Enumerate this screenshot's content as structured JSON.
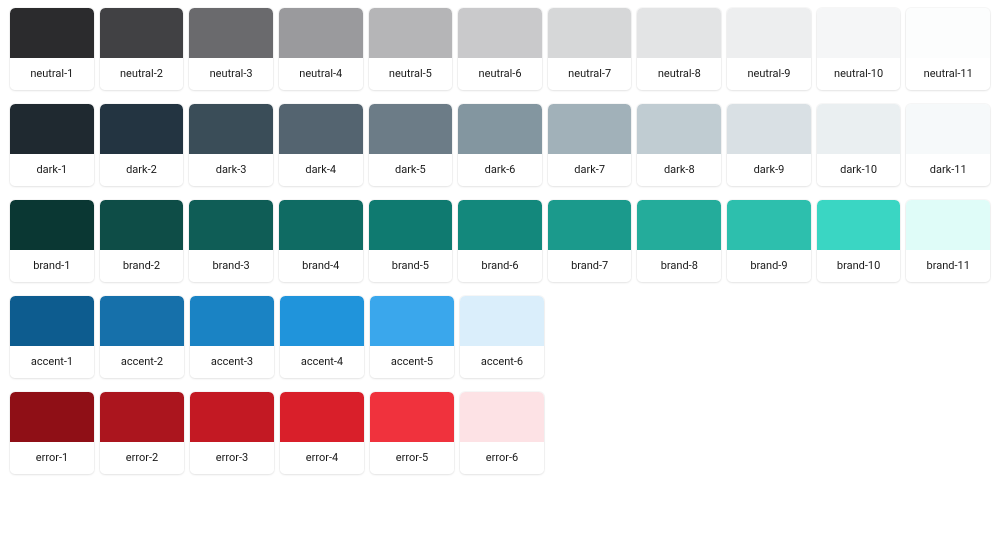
{
  "palettes": [
    {
      "name": "neutral",
      "swatches": [
        {
          "label": "neutral-1",
          "color": "#2b2b2d"
        },
        {
          "label": "neutral-2",
          "color": "#414144"
        },
        {
          "label": "neutral-3",
          "color": "#6a6a6d"
        },
        {
          "label": "neutral-4",
          "color": "#9a9a9d"
        },
        {
          "label": "neutral-5",
          "color": "#b5b5b7"
        },
        {
          "label": "neutral-6",
          "color": "#c9c9cb"
        },
        {
          "label": "neutral-7",
          "color": "#d6d7d8"
        },
        {
          "label": "neutral-8",
          "color": "#e3e4e5"
        },
        {
          "label": "neutral-9",
          "color": "#edeeef"
        },
        {
          "label": "neutral-10",
          "color": "#f5f6f7"
        },
        {
          "label": "neutral-11",
          "color": "#fcfdfd"
        }
      ]
    },
    {
      "name": "dark",
      "swatches": [
        {
          "label": "dark-1",
          "color": "#1f2930"
        },
        {
          "label": "dark-2",
          "color": "#233441"
        },
        {
          "label": "dark-3",
          "color": "#3a4d58"
        },
        {
          "label": "dark-4",
          "color": "#546470"
        },
        {
          "label": "dark-5",
          "color": "#6c7c87"
        },
        {
          "label": "dark-6",
          "color": "#8396a0"
        },
        {
          "label": "dark-7",
          "color": "#a1b1b9"
        },
        {
          "label": "dark-8",
          "color": "#c0ccd2"
        },
        {
          "label": "dark-9",
          "color": "#d9e0e4"
        },
        {
          "label": "dark-10",
          "color": "#eaeff1"
        },
        {
          "label": "dark-11",
          "color": "#f6f9fa"
        }
      ]
    },
    {
      "name": "brand",
      "swatches": [
        {
          "label": "brand-1",
          "color": "#0a3733"
        },
        {
          "label": "brand-2",
          "color": "#0e4d47"
        },
        {
          "label": "brand-3",
          "color": "#0f5d56"
        },
        {
          "label": "brand-4",
          "color": "#0f6b63"
        },
        {
          "label": "brand-5",
          "color": "#0f7a70"
        },
        {
          "label": "brand-6",
          "color": "#13887c"
        },
        {
          "label": "brand-7",
          "color": "#1b9a8c"
        },
        {
          "label": "brand-8",
          "color": "#24ac9b"
        },
        {
          "label": "brand-9",
          "color": "#2dbfad"
        },
        {
          "label": "brand-10",
          "color": "#3ad6c3"
        },
        {
          "label": "brand-11",
          "color": "#dffcf8"
        }
      ]
    },
    {
      "name": "accent",
      "swatches": [
        {
          "label": "accent-1",
          "color": "#0d5c8f"
        },
        {
          "label": "accent-2",
          "color": "#1670aa"
        },
        {
          "label": "accent-3",
          "color": "#1a83c4"
        },
        {
          "label": "accent-4",
          "color": "#2094db"
        },
        {
          "label": "accent-5",
          "color": "#3aa7ec"
        },
        {
          "label": "accent-6",
          "color": "#daeefb"
        }
      ]
    },
    {
      "name": "error",
      "swatches": [
        {
          "label": "error-1",
          "color": "#8f0f16"
        },
        {
          "label": "error-2",
          "color": "#ab151e"
        },
        {
          "label": "error-3",
          "color": "#c31923"
        },
        {
          "label": "error-4",
          "color": "#d91f2a"
        },
        {
          "label": "error-5",
          "color": "#f0323d"
        },
        {
          "label": "error-6",
          "color": "#fde2e5"
        }
      ]
    }
  ]
}
